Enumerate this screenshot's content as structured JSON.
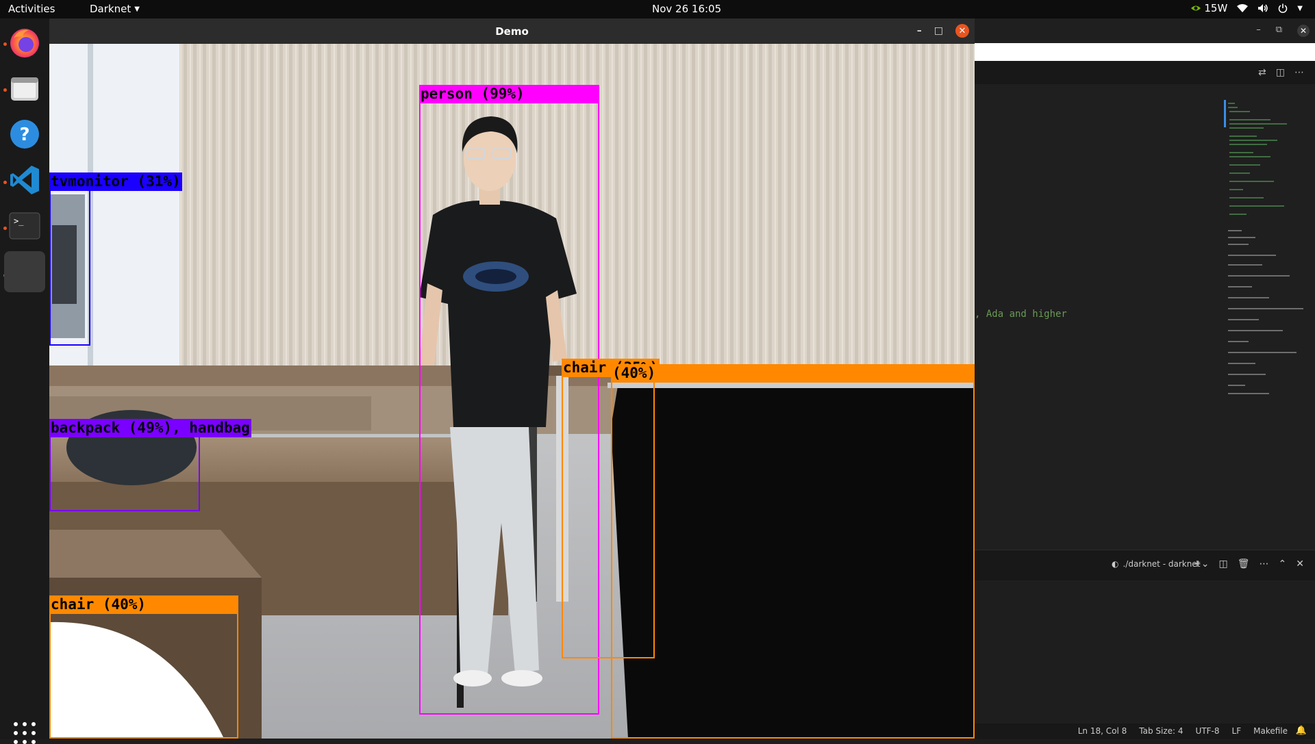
{
  "topbar": {
    "activities": "Activities",
    "app_name": "Darknet",
    "clock": "Nov 26  16:05",
    "power_draw": "15W"
  },
  "demo_window": {
    "title": "Demo"
  },
  "detections": [
    {
      "label": "person (99%)",
      "color": "#ff00ff"
    },
    {
      "label": "tvmonitor (31%)",
      "color": "#1a00ff"
    },
    {
      "label": "backpack (49%), handbag",
      "color": "#7a00ff"
    },
    {
      "label": "chair (35%)",
      "color": "#ff8800"
    },
    {
      "label": "(40%)",
      "color": "#ff8800"
    },
    {
      "label": "chair (40%)",
      "color": "#ff8800"
    }
  ],
  "vscode": {
    "code_fragment": ", Ada and higher",
    "terminal_name": "./darknet - darknet",
    "status": {
      "position": "Ln 18, Col 8",
      "tab_size": "Tab Size: 4",
      "encoding": "UTF-8",
      "eol": "LF",
      "language": "Makefile"
    }
  },
  "colors": {
    "ubuntu_orange": "#e95420",
    "person_box": "#ff00ff",
    "tvmonitor_box": "#1a00ff",
    "backpack_box": "#7a00ff",
    "chair_box": "#ff8800"
  }
}
